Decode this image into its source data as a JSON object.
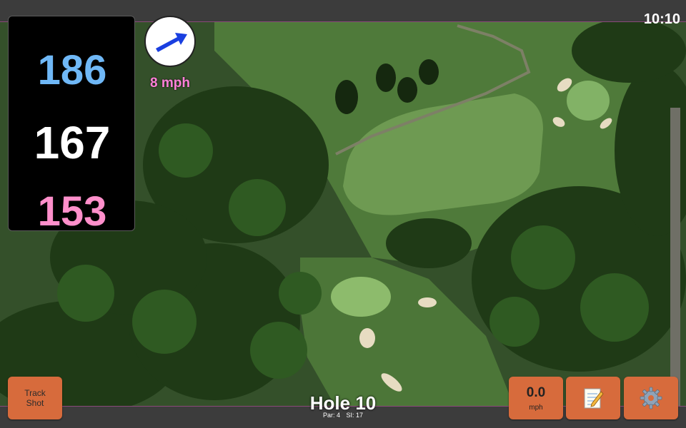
{
  "status_bar": {
    "clock": "10:10"
  },
  "distances": {
    "back": "186",
    "middle": "167",
    "front": "153"
  },
  "wind": {
    "speed": "8 mph",
    "direction_icon": "arrow-up-right-icon"
  },
  "hole": {
    "title": "Hole 10",
    "par": "Par: 4",
    "stroke_index": "SI: 17"
  },
  "buttons": {
    "track_shot": "Track Shot",
    "speed_value": "0.0",
    "speed_unit": "mph",
    "notes_icon": "notepad-icon",
    "settings_icon": "gear-icon"
  },
  "colors": {
    "back_distance": "#6fb8f7",
    "middle_distance": "#ffffff",
    "front_distance": "#ff8fcb",
    "wind_text": "#ff80d8",
    "button": "#d76b3c",
    "arrow": "#1a3fe0"
  }
}
